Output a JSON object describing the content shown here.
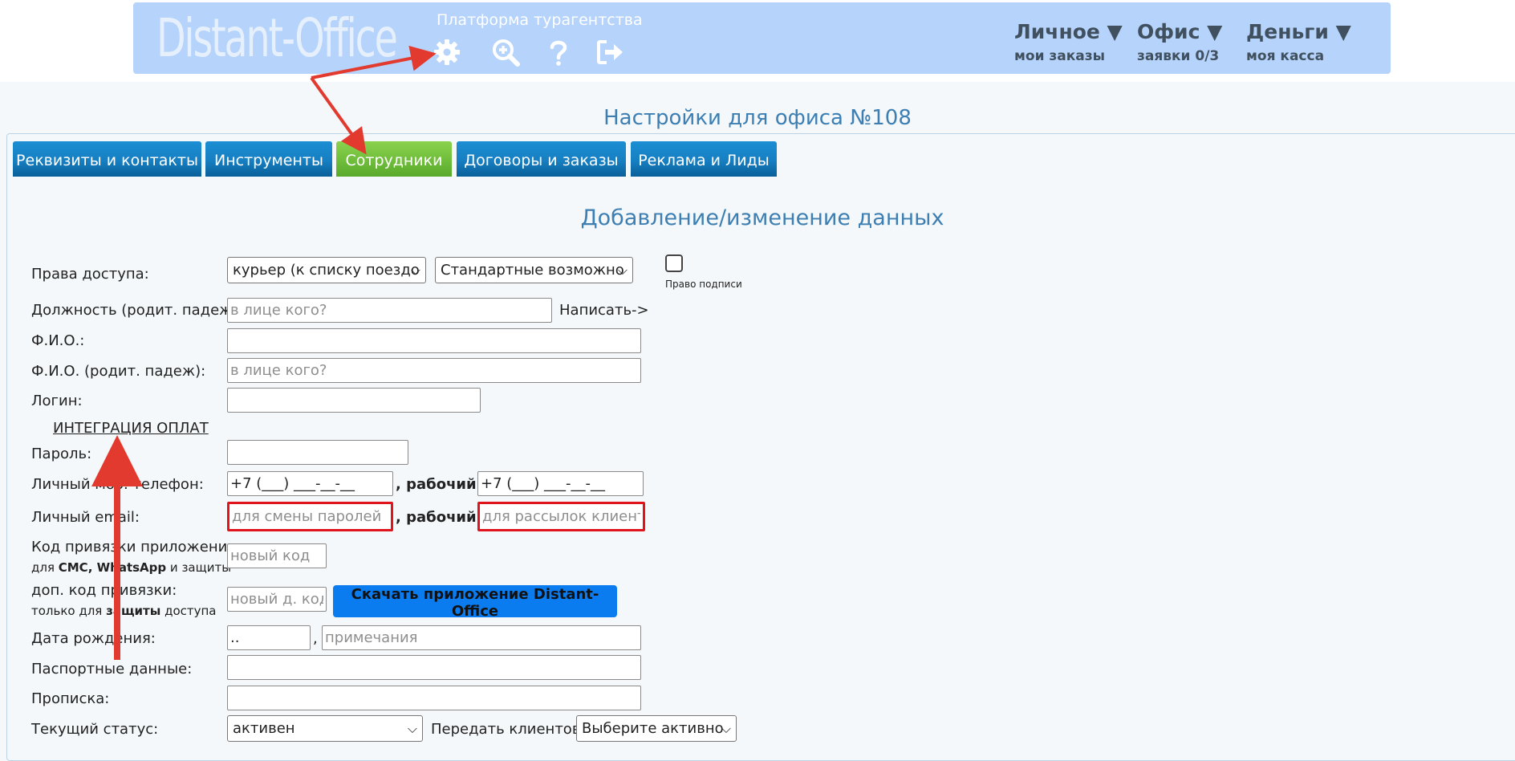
{
  "header": {
    "logo": "Distant-Office",
    "platform_title": "Платформа турагентства",
    "icons": [
      "gear-icon",
      "zoom-in-icon",
      "question-icon",
      "logout-icon"
    ],
    "menus": [
      {
        "title": "Личное ▼",
        "sub": "мои заказы"
      },
      {
        "title": "Офис ▼",
        "sub": "заявки 0/3"
      },
      {
        "title": "Деньги ▼",
        "sub": "моя касса"
      }
    ]
  },
  "page_title": "Настройки для офиса №108",
  "tabs": [
    "Реквизиты и контакты",
    "Инструменты",
    "Сотрудники",
    "Договоры и заказы",
    "Реклама и Лиды"
  ],
  "active_tab": "Сотрудники",
  "section_title": "Добавление/изменение данных",
  "form": {
    "access_label": "Права доступа:",
    "access_select": "курьер (к списку поездо",
    "access_select2": "Стандартные возможно",
    "sign_right_label": "Право подписи",
    "position_label": "Должность (родит. падеж):",
    "position_placeholder": "в лице кого?",
    "write_link": "Написать->",
    "fio_label": "Ф.И.О.:",
    "fio_gen_label": "Ф.И.О. (родит. падеж):",
    "fio_gen_placeholder": "в лице кого?",
    "login_label": "Логин:",
    "integration_link": "ИНТЕГРАЦИЯ ОПЛАТ",
    "password_label": "Пароль:",
    "phone_label": "Личный моб. телефон:",
    "phone_value": "+7 (___) ___-__-__",
    "work_label": ", рабочий:",
    "work_phone_value": "+7 (___) ___-__-__",
    "email_label": "Личный email:",
    "email_placeholder": "для смены паролей",
    "work_email_placeholder": "для рассылок клиента",
    "app_code_label": "Код привязки приложения:",
    "app_code_sub_1": "для ",
    "app_code_sub_bold": "СМС, WhatsApp",
    "app_code_sub_2": " и защиты",
    "app_code_placeholder": "новый код",
    "extra_code_label": "доп. код привязки:",
    "extra_code_sub_1": "только для ",
    "extra_code_sub_bold": "защиты",
    "extra_code_sub_2": " доступа",
    "extra_code_placeholder": "новый д. код",
    "download_button": "Скачать приложение Distant-Office",
    "birth_label": "Дата рождения:",
    "birth_value": "..",
    "comma": ",",
    "notes_placeholder": "примечания",
    "passport_label": "Паспортные данные:",
    "registration_label": "Прописка:",
    "status_label": "Текущий статус:",
    "status_select": "активен",
    "transfer_label": "Передать клиентов:",
    "transfer_select": "Выберите активно"
  },
  "colors": {
    "header_bg": "#b5d3fb",
    "tab_blue": "#167fc2",
    "tab_active_green": "#6fbd3b",
    "title_blue": "#3d7fb3",
    "highlight_red": "#e0141c",
    "download_button": "#0a7cf0"
  }
}
